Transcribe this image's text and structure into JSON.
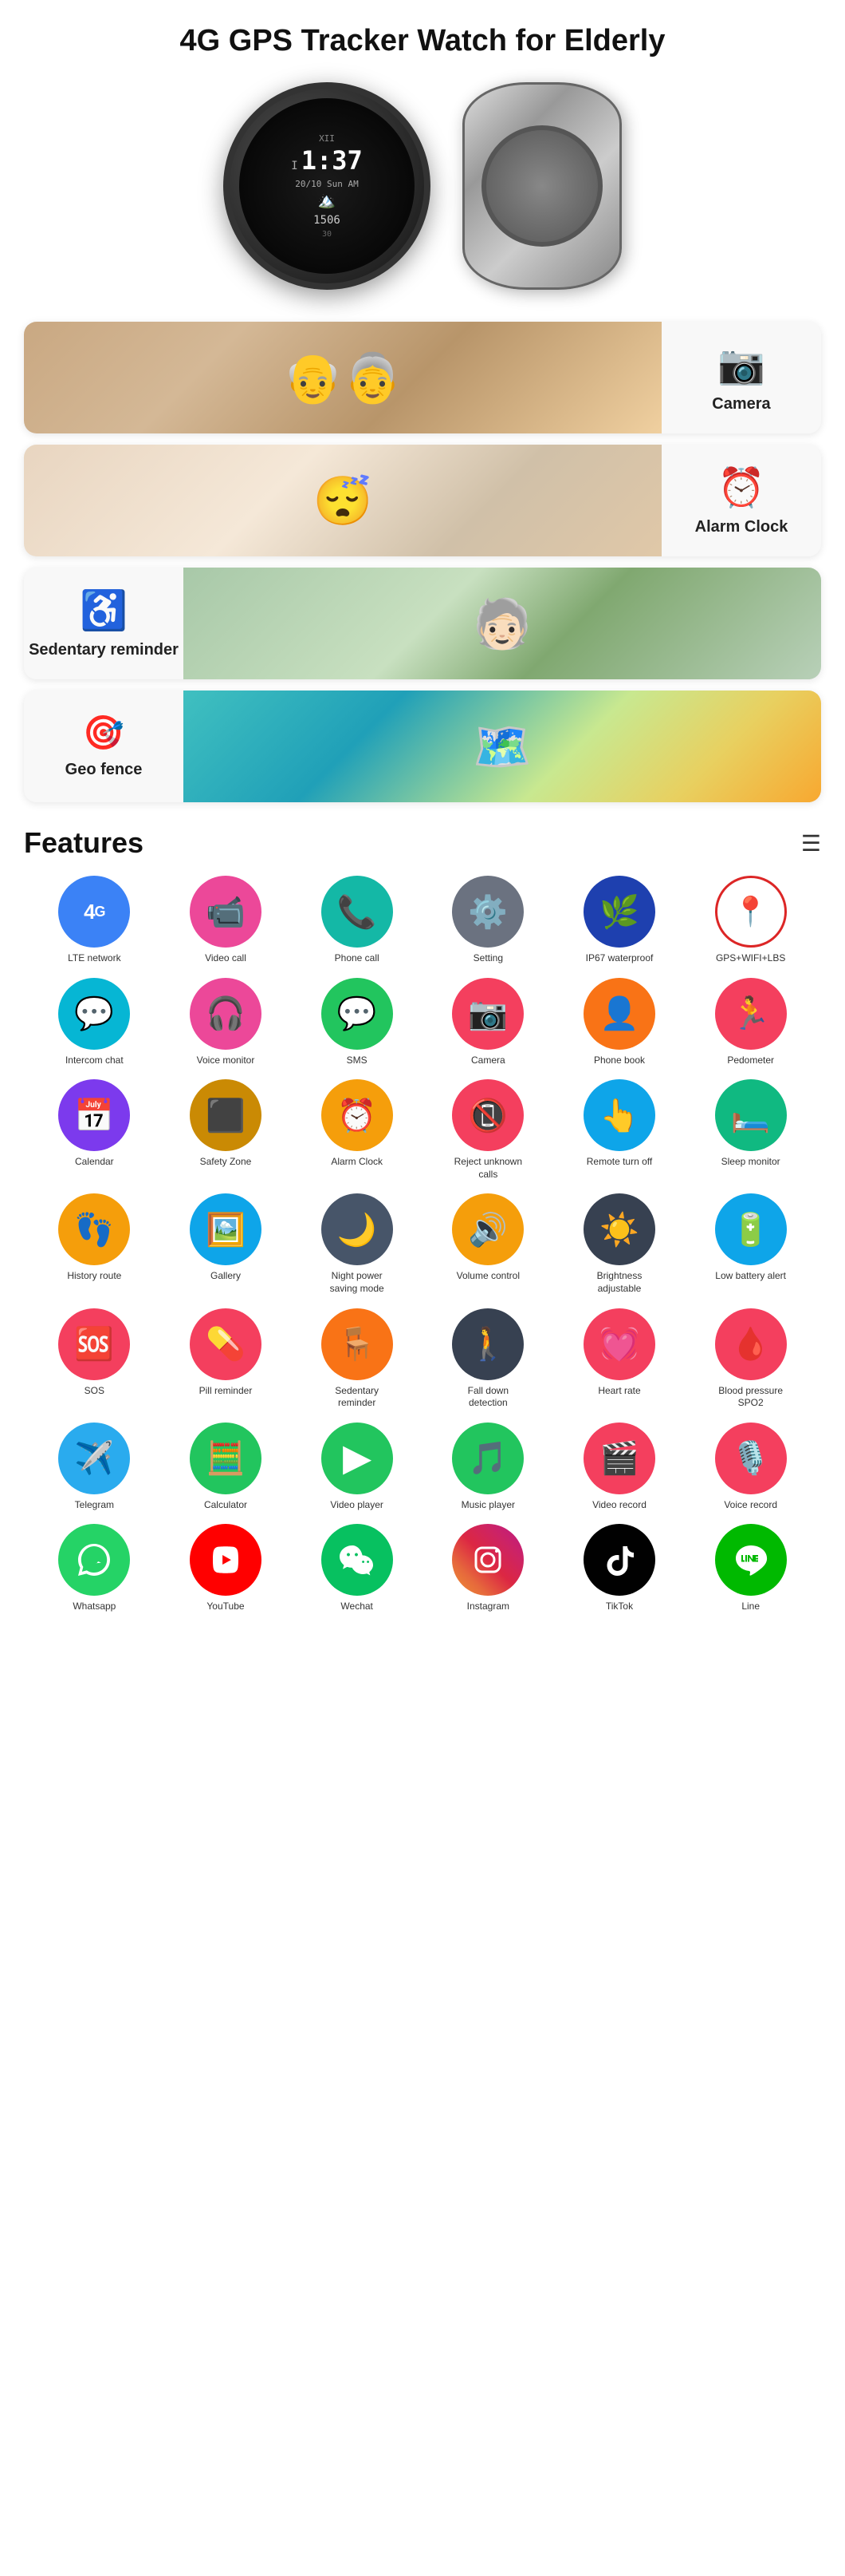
{
  "title": "4G GPS Tracker Watch for Elderly",
  "banners": [
    {
      "id": "camera",
      "label": "Camera",
      "icon": "📷",
      "img_class": "img-elderly",
      "reverse": false
    },
    {
      "id": "alarm",
      "label": "Alarm Clock",
      "icon": "⏰",
      "img_class": "img-sleep",
      "reverse": false
    },
    {
      "id": "sedentary",
      "label": "Sedentary reminder",
      "icon": "♿",
      "img_class": "img-exercise",
      "reverse": true
    },
    {
      "id": "geofence",
      "label": "Geo fence",
      "icon": "🎯",
      "img_class": "img-geo",
      "reverse": true
    }
  ],
  "features_title": "Features",
  "icons": [
    {
      "id": "lte",
      "label": "LTE network",
      "emoji": "4G",
      "bg": "bg-blue",
      "text_style": "font-size:22px;font-weight:bold;"
    },
    {
      "id": "videocall",
      "label": "Video call",
      "emoji": "📹",
      "bg": "bg-pink"
    },
    {
      "id": "phonecall",
      "label": "Phone call",
      "emoji": "📞",
      "bg": "bg-teal"
    },
    {
      "id": "setting",
      "label": "Setting",
      "emoji": "⚙️",
      "bg": "bg-gray"
    },
    {
      "id": "waterproof",
      "label": "IP67 waterproof",
      "emoji": "🌿",
      "bg": "bg-darkblue"
    },
    {
      "id": "gps",
      "label": "GPS+WIFI+LBS",
      "emoji": "📍",
      "bg": "red-circle",
      "is_outline": true
    },
    {
      "id": "intercom",
      "label": "Intercom chat",
      "emoji": "💬",
      "bg": "bg-cyan"
    },
    {
      "id": "voice",
      "label": "Voice monitor",
      "emoji": "🎧",
      "bg": "bg-pink"
    },
    {
      "id": "sms",
      "label": "SMS",
      "emoji": "💬",
      "bg": "bg-green"
    },
    {
      "id": "camera2",
      "label": "Camera",
      "emoji": "📷",
      "bg": "bg-rose"
    },
    {
      "id": "phonebook",
      "label": "Phone book",
      "emoji": "👤",
      "bg": "bg-orange"
    },
    {
      "id": "pedometer",
      "label": "Pedometer",
      "emoji": "🏃",
      "bg": "bg-rose"
    },
    {
      "id": "calendar",
      "label": "Calendar",
      "emoji": "📅",
      "bg": "bg-violet"
    },
    {
      "id": "safetyzone",
      "label": "Safety Zone",
      "emoji": "⬛",
      "bg": "bg-gold"
    },
    {
      "id": "alarmclock",
      "label": "Alarm Clock",
      "emoji": "⏰",
      "bg": "bg-amber"
    },
    {
      "id": "rejectcalls",
      "label": "Reject unknown calls",
      "emoji": "📵",
      "bg": "bg-rose"
    },
    {
      "id": "remoteturnoff",
      "label": "Remote turn off",
      "emoji": "👆",
      "bg": "bg-sky"
    },
    {
      "id": "sleepmonitor",
      "label": "Sleep monitor",
      "emoji": "🛏️",
      "bg": "bg-emerald"
    },
    {
      "id": "historyroute",
      "label": "History route",
      "emoji": "👣",
      "bg": "bg-amber"
    },
    {
      "id": "gallery",
      "label": "Gallery",
      "emoji": "🖼️",
      "bg": "bg-sky"
    },
    {
      "id": "nightmode",
      "label": "Night power saving mode",
      "emoji": "🌙",
      "bg": "bg-slate"
    },
    {
      "id": "volume",
      "label": "Volume control",
      "emoji": "🔊",
      "bg": "bg-amber"
    },
    {
      "id": "brightness",
      "label": "Brightness adjustable",
      "emoji": "⊙",
      "bg": "bg-darkgray"
    },
    {
      "id": "lowbattery",
      "label": "Low battery alert",
      "emoji": "🔋",
      "bg": "bg-sky"
    },
    {
      "id": "sos",
      "label": "SOS",
      "emoji": "🆘",
      "bg": "bg-rose"
    },
    {
      "id": "pill",
      "label": "Pill reminder",
      "emoji": "💊",
      "bg": "bg-rose"
    },
    {
      "id": "sedentary2",
      "label": "Sedentary reminder",
      "emoji": "🪑",
      "bg": "bg-orange"
    },
    {
      "id": "falldown",
      "label": "Fall down detection",
      "emoji": "🚶",
      "bg": "bg-darkgray"
    },
    {
      "id": "heartrate",
      "label": "Heart rate",
      "emoji": "💓",
      "bg": "bg-rose"
    },
    {
      "id": "bpspo2",
      "label": "Blood pressure SPO2",
      "emoji": "🩸",
      "bg": "bg-rose"
    },
    {
      "id": "telegram",
      "label": "Telegram",
      "emoji": "✈️",
      "bg": "bg-telegram"
    },
    {
      "id": "calculator",
      "label": "Calculator",
      "emoji": "🧮",
      "bg": "bg-green"
    },
    {
      "id": "videoplayer",
      "label": "Video player",
      "emoji": "▶️",
      "bg": "bg-green"
    },
    {
      "id": "musicplayer",
      "label": "Music player",
      "emoji": "🎵",
      "bg": "bg-green"
    },
    {
      "id": "videorecord",
      "label": "Video record",
      "emoji": "🎬",
      "bg": "bg-rose"
    },
    {
      "id": "voicerecord",
      "label": "Voice record",
      "emoji": "🎙️",
      "bg": "bg-rose"
    },
    {
      "id": "whatsapp",
      "label": "Whatsapp",
      "emoji": "📱",
      "bg": "bg-whatsapp"
    },
    {
      "id": "youtube",
      "label": "YouTube",
      "emoji": "▶",
      "bg": "bg-youtube"
    },
    {
      "id": "wechat",
      "label": "Wechat",
      "emoji": "💬",
      "bg": "bg-wechat"
    },
    {
      "id": "instagram",
      "label": "Instagram",
      "emoji": "📸",
      "bg": "bg-instagram"
    },
    {
      "id": "tiktok",
      "label": "TikTok",
      "emoji": "♪",
      "bg": "bg-tiktok"
    },
    {
      "id": "line",
      "label": "Line",
      "emoji": "💬",
      "bg": "bg-line"
    }
  ],
  "watch": {
    "time": "1:37",
    "date": "20/10  Sun AM",
    "steps": "1506"
  }
}
